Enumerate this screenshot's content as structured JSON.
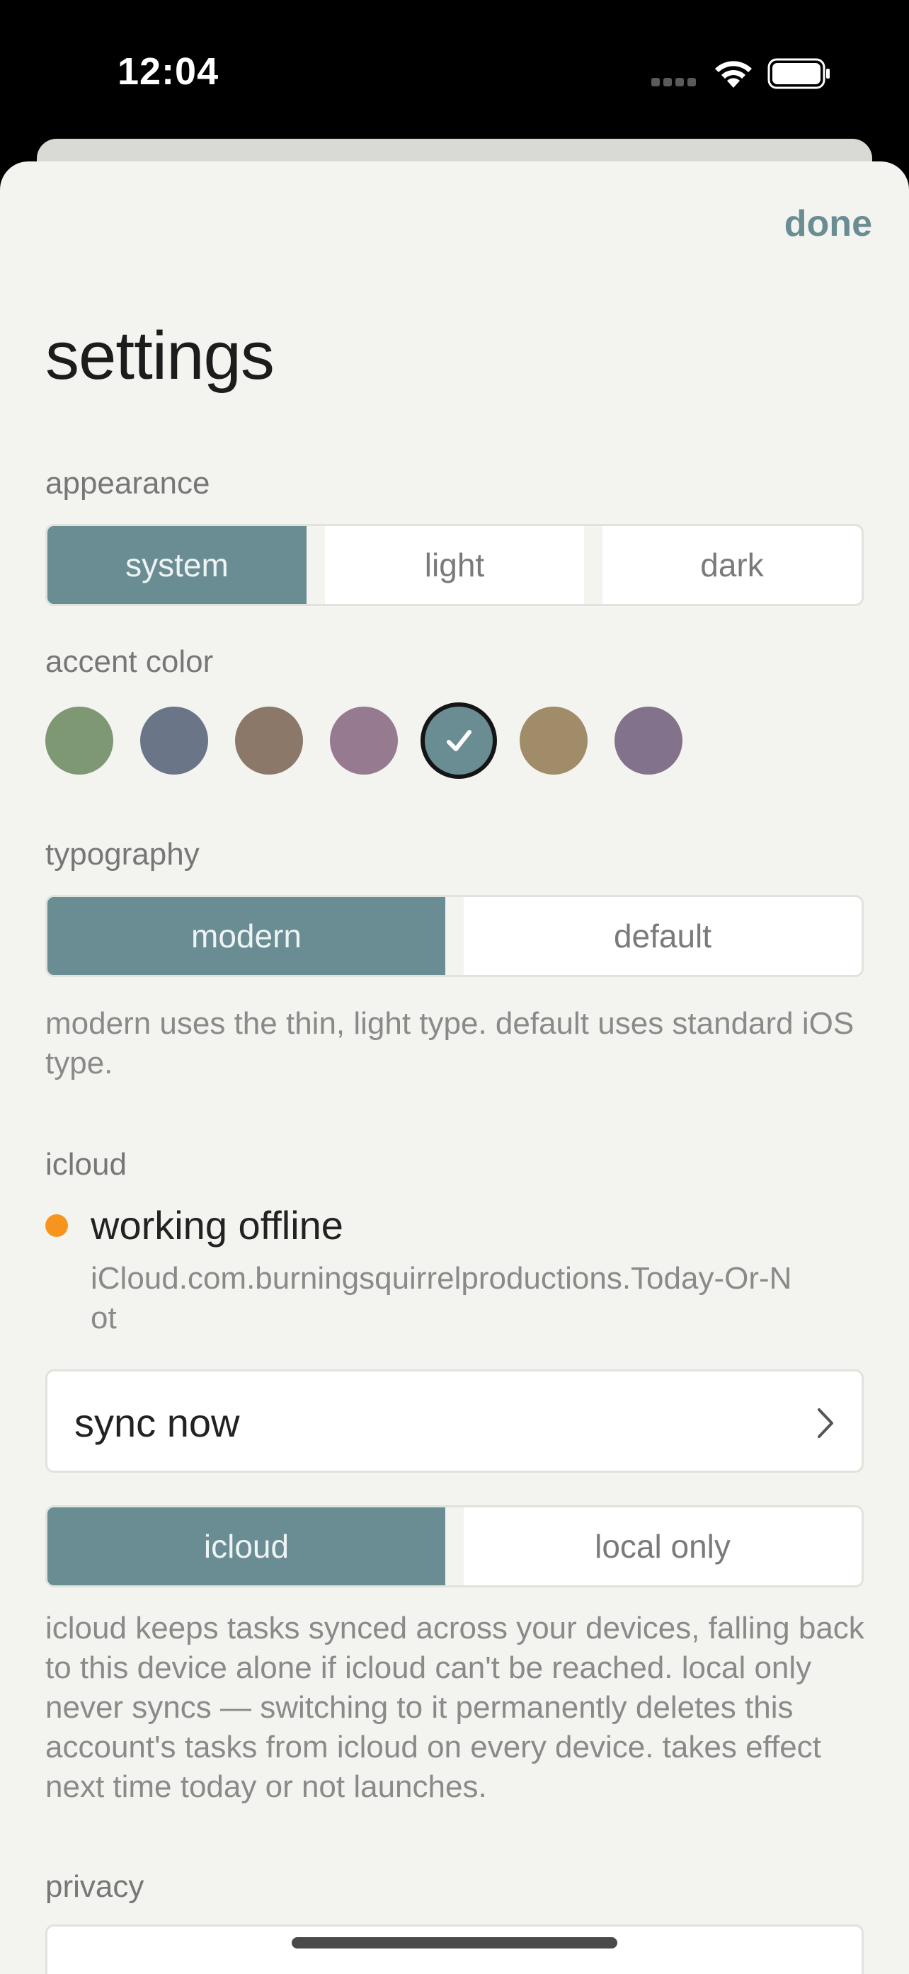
{
  "status_bar": {
    "time": "12:04"
  },
  "header": {
    "done_label": "done",
    "title": "settings"
  },
  "appearance": {
    "label": "appearance",
    "options": [
      "system",
      "light",
      "dark"
    ],
    "selected": "system"
  },
  "accent": {
    "label": "accent color",
    "colors": [
      "#7e9874",
      "#6a7688",
      "#8c7868",
      "#967a90",
      "#6a8c93",
      "#a08c68",
      "#82728c"
    ],
    "selected_index": 4
  },
  "typography": {
    "label": "typography",
    "options": [
      "modern",
      "default"
    ],
    "selected": "modern",
    "help": "modern uses the thin, light type. default uses standard iOS type."
  },
  "icloud": {
    "label": "icloud",
    "status_title": "working offline",
    "status_color": "#f7941d",
    "container_id": "iCloud.com.burningsquirrelproductions.Today-Or-Not",
    "sync_label": "sync now",
    "mode_options": [
      "icloud",
      "local only"
    ],
    "mode_selected": "icloud",
    "help": "icloud keeps tasks synced across your devices, falling back to this device alone if icloud can't be reached. local only never syncs — switching to it permanently deletes this account's tasks from icloud on every device. takes effect next time today or not launches."
  },
  "privacy": {
    "label": "privacy"
  },
  "colors": {
    "accent": "#6a8c93",
    "background": "#f3f3ef"
  }
}
